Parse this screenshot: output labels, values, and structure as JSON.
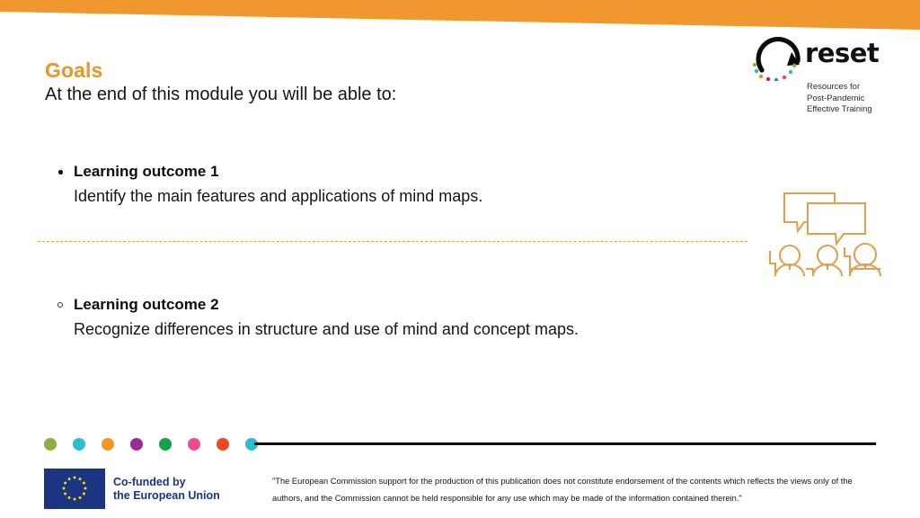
{
  "slide": {
    "title": "Goals",
    "subtitle": "At the end of this module you will be able to:",
    "accent_color": "#E99528",
    "banner_color": "#F0982D"
  },
  "logo": {
    "wordmark": "reset",
    "tagline": "Resources for\nPost-Pandemic\nEffective Training",
    "dot_colors": [
      "#9aad45",
      "#2bb8c9",
      "#e8912c",
      "#9a2a8e",
      "#1da557",
      "#ec3f8e",
      "#2bb8c9"
    ]
  },
  "outcomes": [
    {
      "bullet": "filled",
      "heading": "Learning outcome 1",
      "text": "Identify the main features and applications of mind maps."
    },
    {
      "bullet": "hollow",
      "heading": "Learning outcome 2",
      "text": "Recognize differences in structure and use of mind and concept maps."
    }
  ],
  "illustration": {
    "name": "three-people-speech-bubbles",
    "color": "#E0A050"
  },
  "dot_row": {
    "colors": [
      "#8FAE4A",
      "#2DBCD3",
      "#F2971F",
      "#9B2C96",
      "#13A14E",
      "#EE4C95",
      "#EE4A22",
      "#2DBCD3"
    ]
  },
  "footer": {
    "eu_funding": "Co-funded by\nthe European Union",
    "disclaimer": "\"The European Commission support for the production of this publication does not constitute endorsement of the contents which reflects the views only of the authors, and the Commission cannot be held responsible for any use which may be made of the information contained  therein.\""
  }
}
